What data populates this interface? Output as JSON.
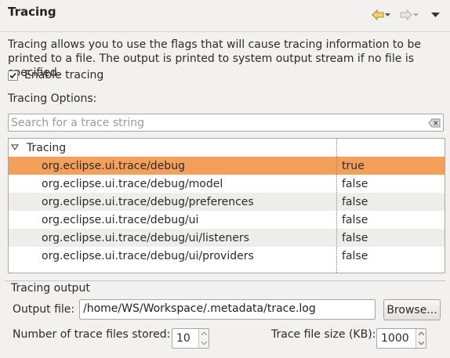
{
  "header": {
    "title": "Tracing"
  },
  "description": "Tracing allows you to use the flags that will cause tracing information to be printed to a file. The output is printed to system output stream if no file is specified.",
  "enable_tracing": {
    "label": "Enable tracing",
    "checked": true
  },
  "tracing_options_label": "Tracing Options:",
  "search": {
    "placeholder": "Search for a trace string"
  },
  "tree": {
    "root": "Tracing",
    "rows": [
      {
        "name": "org.eclipse.ui.trace/debug",
        "value": "true"
      },
      {
        "name": "org.eclipse.ui.trace/debug/model",
        "value": "false"
      },
      {
        "name": "org.eclipse.ui.trace/debug/preferences",
        "value": "false"
      },
      {
        "name": "org.eclipse.ui.trace/debug/ui",
        "value": "false"
      },
      {
        "name": "org.eclipse.ui.trace/debug/ui/listeners",
        "value": "false"
      },
      {
        "name": "org.eclipse.ui.trace/debug/ui/providers",
        "value": "false"
      }
    ]
  },
  "output": {
    "legend": "Tracing output",
    "file_label": "Output file:",
    "file_value": "/home/WS/Workspace/.metadata/trace.log",
    "browse_label": "Browse...",
    "num_files_label": "Number of trace files stored:",
    "num_files_value": "10",
    "size_label": "Trace file size (KB):",
    "size_value": "1000"
  },
  "colors": {
    "selection": "#f5a05a",
    "nav_arrow": "#e8c85a"
  }
}
